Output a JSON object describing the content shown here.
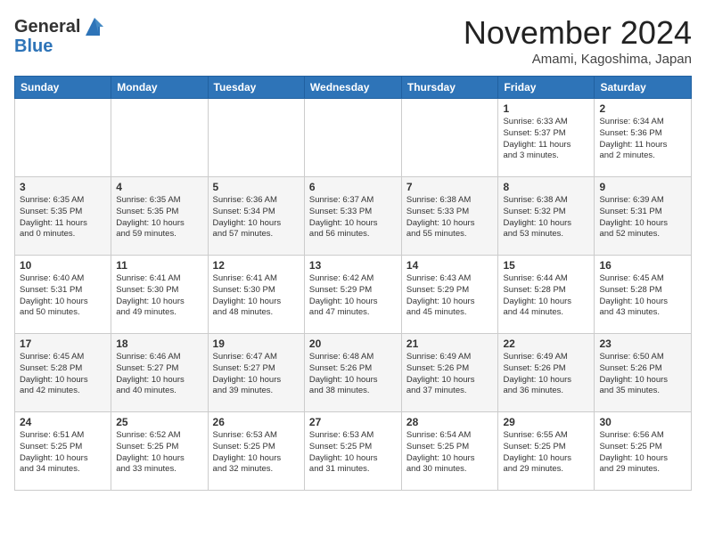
{
  "header": {
    "logo_line1": "General",
    "logo_line2": "Blue",
    "month": "November 2024",
    "location": "Amami, Kagoshima, Japan"
  },
  "weekdays": [
    "Sunday",
    "Monday",
    "Tuesday",
    "Wednesday",
    "Thursday",
    "Friday",
    "Saturday"
  ],
  "weeks": [
    [
      {
        "day": "",
        "info": ""
      },
      {
        "day": "",
        "info": ""
      },
      {
        "day": "",
        "info": ""
      },
      {
        "day": "",
        "info": ""
      },
      {
        "day": "",
        "info": ""
      },
      {
        "day": "1",
        "info": "Sunrise: 6:33 AM\nSunset: 5:37 PM\nDaylight: 11 hours\nand 3 minutes."
      },
      {
        "day": "2",
        "info": "Sunrise: 6:34 AM\nSunset: 5:36 PM\nDaylight: 11 hours\nand 2 minutes."
      }
    ],
    [
      {
        "day": "3",
        "info": "Sunrise: 6:35 AM\nSunset: 5:35 PM\nDaylight: 11 hours\nand 0 minutes."
      },
      {
        "day": "4",
        "info": "Sunrise: 6:35 AM\nSunset: 5:35 PM\nDaylight: 10 hours\nand 59 minutes."
      },
      {
        "day": "5",
        "info": "Sunrise: 6:36 AM\nSunset: 5:34 PM\nDaylight: 10 hours\nand 57 minutes."
      },
      {
        "day": "6",
        "info": "Sunrise: 6:37 AM\nSunset: 5:33 PM\nDaylight: 10 hours\nand 56 minutes."
      },
      {
        "day": "7",
        "info": "Sunrise: 6:38 AM\nSunset: 5:33 PM\nDaylight: 10 hours\nand 55 minutes."
      },
      {
        "day": "8",
        "info": "Sunrise: 6:38 AM\nSunset: 5:32 PM\nDaylight: 10 hours\nand 53 minutes."
      },
      {
        "day": "9",
        "info": "Sunrise: 6:39 AM\nSunset: 5:31 PM\nDaylight: 10 hours\nand 52 minutes."
      }
    ],
    [
      {
        "day": "10",
        "info": "Sunrise: 6:40 AM\nSunset: 5:31 PM\nDaylight: 10 hours\nand 50 minutes."
      },
      {
        "day": "11",
        "info": "Sunrise: 6:41 AM\nSunset: 5:30 PM\nDaylight: 10 hours\nand 49 minutes."
      },
      {
        "day": "12",
        "info": "Sunrise: 6:41 AM\nSunset: 5:30 PM\nDaylight: 10 hours\nand 48 minutes."
      },
      {
        "day": "13",
        "info": "Sunrise: 6:42 AM\nSunset: 5:29 PM\nDaylight: 10 hours\nand 47 minutes."
      },
      {
        "day": "14",
        "info": "Sunrise: 6:43 AM\nSunset: 5:29 PM\nDaylight: 10 hours\nand 45 minutes."
      },
      {
        "day": "15",
        "info": "Sunrise: 6:44 AM\nSunset: 5:28 PM\nDaylight: 10 hours\nand 44 minutes."
      },
      {
        "day": "16",
        "info": "Sunrise: 6:45 AM\nSunset: 5:28 PM\nDaylight: 10 hours\nand 43 minutes."
      }
    ],
    [
      {
        "day": "17",
        "info": "Sunrise: 6:45 AM\nSunset: 5:28 PM\nDaylight: 10 hours\nand 42 minutes."
      },
      {
        "day": "18",
        "info": "Sunrise: 6:46 AM\nSunset: 5:27 PM\nDaylight: 10 hours\nand 40 minutes."
      },
      {
        "day": "19",
        "info": "Sunrise: 6:47 AM\nSunset: 5:27 PM\nDaylight: 10 hours\nand 39 minutes."
      },
      {
        "day": "20",
        "info": "Sunrise: 6:48 AM\nSunset: 5:26 PM\nDaylight: 10 hours\nand 38 minutes."
      },
      {
        "day": "21",
        "info": "Sunrise: 6:49 AM\nSunset: 5:26 PM\nDaylight: 10 hours\nand 37 minutes."
      },
      {
        "day": "22",
        "info": "Sunrise: 6:49 AM\nSunset: 5:26 PM\nDaylight: 10 hours\nand 36 minutes."
      },
      {
        "day": "23",
        "info": "Sunrise: 6:50 AM\nSunset: 5:26 PM\nDaylight: 10 hours\nand 35 minutes."
      }
    ],
    [
      {
        "day": "24",
        "info": "Sunrise: 6:51 AM\nSunset: 5:25 PM\nDaylight: 10 hours\nand 34 minutes."
      },
      {
        "day": "25",
        "info": "Sunrise: 6:52 AM\nSunset: 5:25 PM\nDaylight: 10 hours\nand 33 minutes."
      },
      {
        "day": "26",
        "info": "Sunrise: 6:53 AM\nSunset: 5:25 PM\nDaylight: 10 hours\nand 32 minutes."
      },
      {
        "day": "27",
        "info": "Sunrise: 6:53 AM\nSunset: 5:25 PM\nDaylight: 10 hours\nand 31 minutes."
      },
      {
        "day": "28",
        "info": "Sunrise: 6:54 AM\nSunset: 5:25 PM\nDaylight: 10 hours\nand 30 minutes."
      },
      {
        "day": "29",
        "info": "Sunrise: 6:55 AM\nSunset: 5:25 PM\nDaylight: 10 hours\nand 29 minutes."
      },
      {
        "day": "30",
        "info": "Sunrise: 6:56 AM\nSunset: 5:25 PM\nDaylight: 10 hours\nand 29 minutes."
      }
    ]
  ]
}
